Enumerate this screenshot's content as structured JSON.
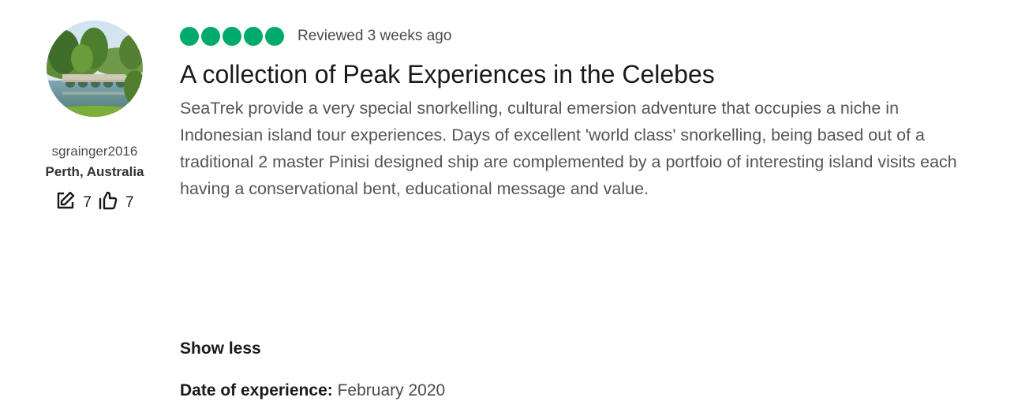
{
  "author": {
    "username": "sgrainger2016",
    "location": "Perth, Australia",
    "stats": {
      "contributions": "7",
      "helpful_votes": "7"
    }
  },
  "review": {
    "rating": 5,
    "rating_max": 5,
    "bubble_color": "#00aa6c",
    "reviewed_text": "Reviewed 3 weeks ago",
    "title": "A collection of Peak Experiences in the Celebes",
    "body": "SeaTrek provide a very special snorkelling, cultural emersion adventure that occupies a niche in Indonesian island tour experiences. Days of excellent 'world class' snorkelling, being based out of a traditional 2 master Pinisi designed ship are complemented by a portfoio of interesting island visits each having a conservational bent, educational message and value.",
    "show_less_label": "Show less",
    "date_of_experience": {
      "label": "Date of experience:",
      "value": "February 2020"
    }
  },
  "icons": {
    "contributions": "pencil-square-icon",
    "helpful_votes": "thumbs-up-icon"
  }
}
